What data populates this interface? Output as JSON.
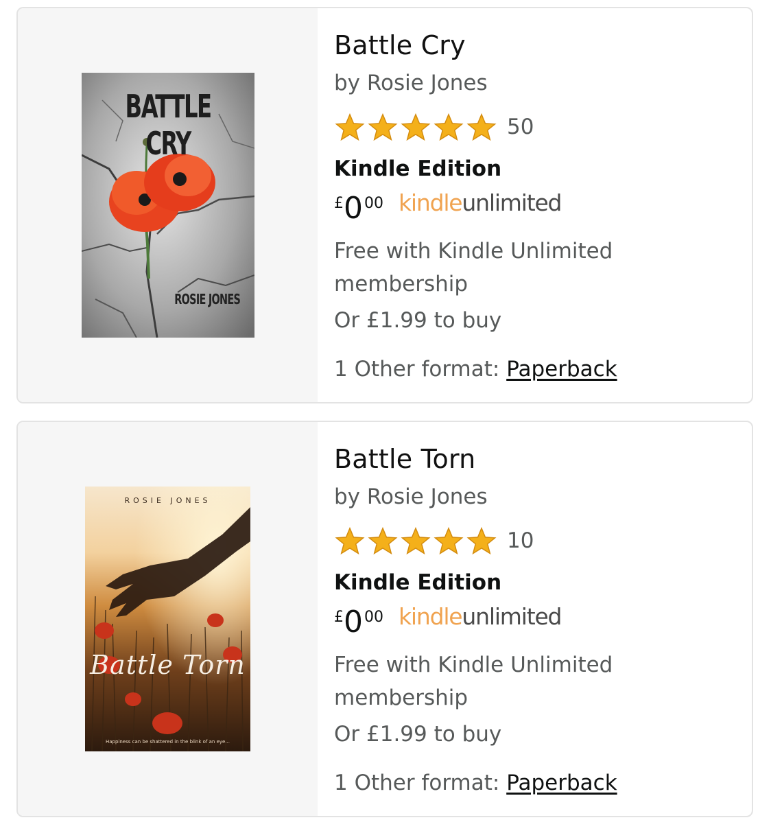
{
  "books": [
    {
      "title": "Battle Cry",
      "author": "by Rosie Jones",
      "rating_count": "50",
      "stars": 5,
      "format": "Kindle Edition",
      "price_symbol": "£",
      "price_whole": "0",
      "price_fraction": "00",
      "ku_kindle": "kindle",
      "ku_unlimited": "unlimited",
      "ku_desc": "Free with Kindle Unlimited membership",
      "buy_line": "Or £1.99 to buy",
      "other_format_label": "1 Other format: ",
      "other_format_link": "Paperback",
      "cover_title": "BATTLE CRY",
      "cover_author": "ROSIE JONES"
    },
    {
      "title": "Battle Torn",
      "author": "by Rosie Jones",
      "rating_count": "10",
      "stars": 5,
      "format": "Kindle Edition",
      "price_symbol": "£",
      "price_whole": "0",
      "price_fraction": "00",
      "ku_kindle": "kindle",
      "ku_unlimited": "unlimited",
      "ku_desc": "Free with Kindle Unlimited membership",
      "buy_line": "Or £1.99 to buy",
      "other_format_label": "1 Other format: ",
      "other_format_link": "Paperback",
      "cover_title": "Battle Torn",
      "cover_author": "ROSIE JONES",
      "cover_tagline": "Happiness can be shattered in the blink of an eye..."
    }
  ],
  "colors": {
    "star": "#f4b01a",
    "kindle": "#f0a350",
    "text_secondary": "#565959",
    "text_primary": "#0f1111"
  }
}
